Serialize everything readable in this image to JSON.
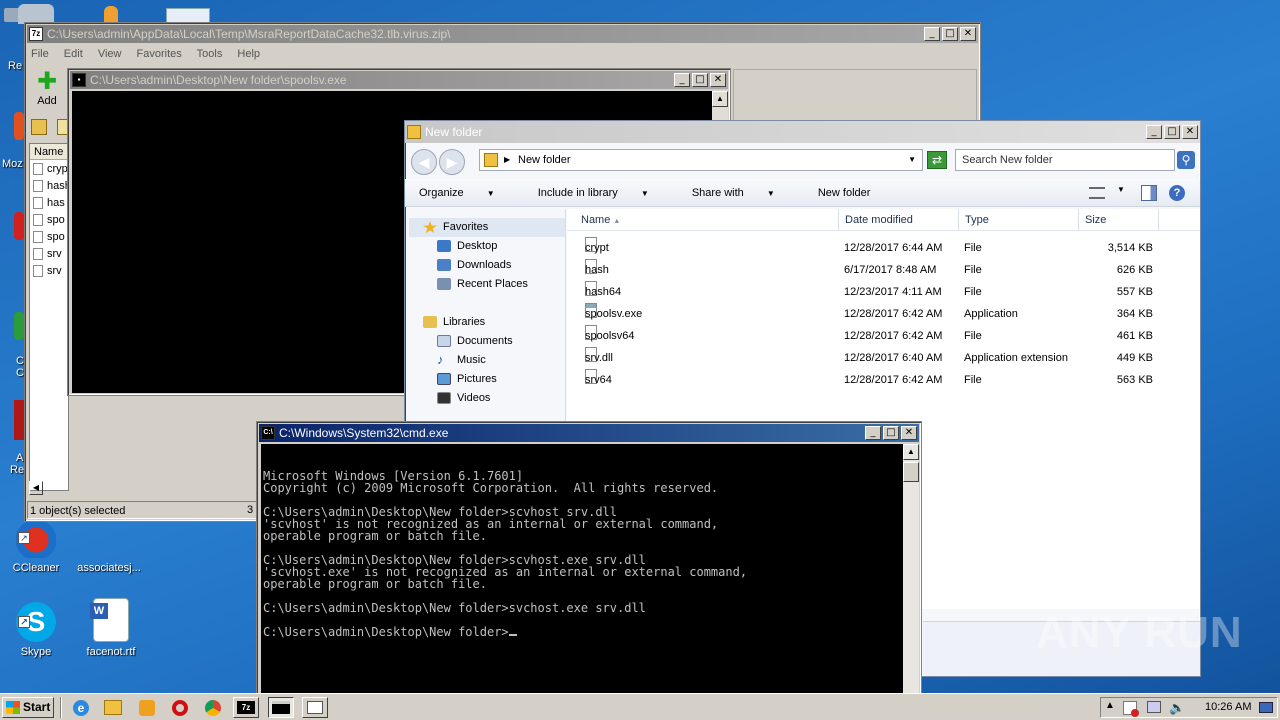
{
  "desktop": {
    "icons": [
      {
        "label": "CCleaner"
      },
      {
        "label": "associatesj..."
      },
      {
        "label": "Skype"
      },
      {
        "label": "facenot.rtf"
      }
    ],
    "left_edge_labels": [
      "Re",
      "Moz",
      "C",
      "C",
      "A",
      "Re"
    ]
  },
  "sevenzip": {
    "title": "C:\\Users\\admin\\AppData\\Local\\Temp\\MsraReportDataCache32.tlb.virus.zip\\",
    "menu": [
      "File",
      "Edit",
      "View",
      "Favorites",
      "Tools",
      "Help"
    ],
    "add_label": "Add",
    "col_name": "Name",
    "files": [
      "cryp",
      "hash",
      "has",
      "spo",
      "spo",
      "srv",
      "srv"
    ],
    "status": "1 object(s) selected",
    "status_right": "3"
  },
  "spoolsv": {
    "title": "C:\\Users\\admin\\Desktop\\New folder\\spoolsv.exe"
  },
  "explorer": {
    "title": "New folder",
    "address": "New folder",
    "search_placeholder": "Search New folder",
    "toolbar": {
      "organize": "Organize",
      "include": "Include in library",
      "share": "Share with",
      "newfolder": "New folder"
    },
    "nav": {
      "favorites": "Favorites",
      "desktop": "Desktop",
      "downloads": "Downloads",
      "recent": "Recent Places",
      "libraries": "Libraries",
      "documents": "Documents",
      "music": "Music",
      "pictures": "Pictures",
      "videos": "Videos"
    },
    "columns": {
      "name": "Name",
      "date": "Date modified",
      "type": "Type",
      "size": "Size"
    },
    "files": [
      {
        "name": "crypt",
        "date": "12/28/2017 6:44 AM",
        "type": "File",
        "size": "3,514 KB"
      },
      {
        "name": "hash",
        "date": "6/17/2017 8:48 AM",
        "type": "File",
        "size": "626 KB"
      },
      {
        "name": "hash64",
        "date": "12/23/2017 4:11 AM",
        "type": "File",
        "size": "557 KB"
      },
      {
        "name": "spoolsv.exe",
        "date": "12/28/2017 6:42 AM",
        "type": "Application",
        "size": "364 KB"
      },
      {
        "name": "spoolsv64",
        "date": "12/28/2017 6:42 AM",
        "type": "File",
        "size": "461 KB"
      },
      {
        "name": "srv.dll",
        "date": "12/28/2017 6:40 AM",
        "type": "Application extension",
        "size": "449 KB"
      },
      {
        "name": "srv64",
        "date": "12/28/2017 6:42 AM",
        "type": "File",
        "size": "563 KB"
      }
    ]
  },
  "cmd": {
    "title": "C:\\Windows\\System32\\cmd.exe",
    "lines": [
      "Microsoft Windows [Version 6.1.7601]",
      "Copyright (c) 2009 Microsoft Corporation.  All rights reserved.",
      "",
      "C:\\Users\\admin\\Desktop\\New folder>scvhost srv.dll",
      "'scvhost' is not recognized as an internal or external command,",
      "operable program or batch file.",
      "",
      "C:\\Users\\admin\\Desktop\\New folder>scvhost.exe srv.dll",
      "'scvhost.exe' is not recognized as an internal or external command,",
      "operable program or batch file.",
      "",
      "C:\\Users\\admin\\Desktop\\New folder>svchost.exe srv.dll",
      "",
      "C:\\Users\\admin\\Desktop\\New folder>"
    ]
  },
  "watermark": "ANY RUN",
  "taskbar": {
    "start": "Start",
    "clock": "10:26 AM"
  }
}
